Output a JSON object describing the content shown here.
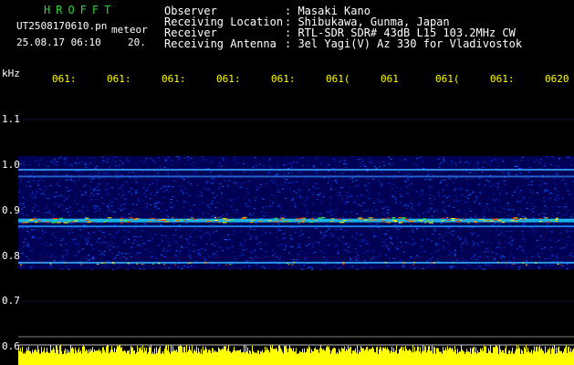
{
  "header": {
    "logo": "HROFFT",
    "filename": "UT2508170610.pn",
    "mode": "meteor",
    "date_time": "25.08.17 06:10",
    "counter": "20.",
    "fields": [
      {
        "label": "Observer",
        "value": ": Masaki Kano"
      },
      {
        "label": "Receiving Location",
        "value": ": Shibukawa, Gunma, Japan"
      },
      {
        "label": "Receiver",
        "value": ": RTL-SDR SDR# 43dB L15 103.2MHz CW"
      },
      {
        "label": "Receiving Antenna",
        "value": ": 3el Yagi(V) Az 330 for Vladivostok"
      }
    ]
  },
  "spectrogram": {
    "y_unit": "kHz",
    "x_ticks": [
      "061:",
      "061:",
      "061:",
      "061:",
      "061:",
      "061(",
      "061",
      "061(",
      "061:",
      "0620"
    ],
    "y_ticks": [
      "1.1",
      "1.0",
      "0.9",
      "0.8",
      "0.7",
      "0.6"
    ],
    "y_range": [
      0.6,
      1.16
    ],
    "band_range": [
      0.77,
      1.02
    ],
    "lines_khz": [
      0.99,
      0.975,
      0.88,
      0.865,
      0.785
    ]
  },
  "colors": {
    "logo": "#2fd33a",
    "text": "#ffffff",
    "ticks": "#ffff00",
    "noise_floor": "#000060",
    "strong": "#ff3000"
  }
}
